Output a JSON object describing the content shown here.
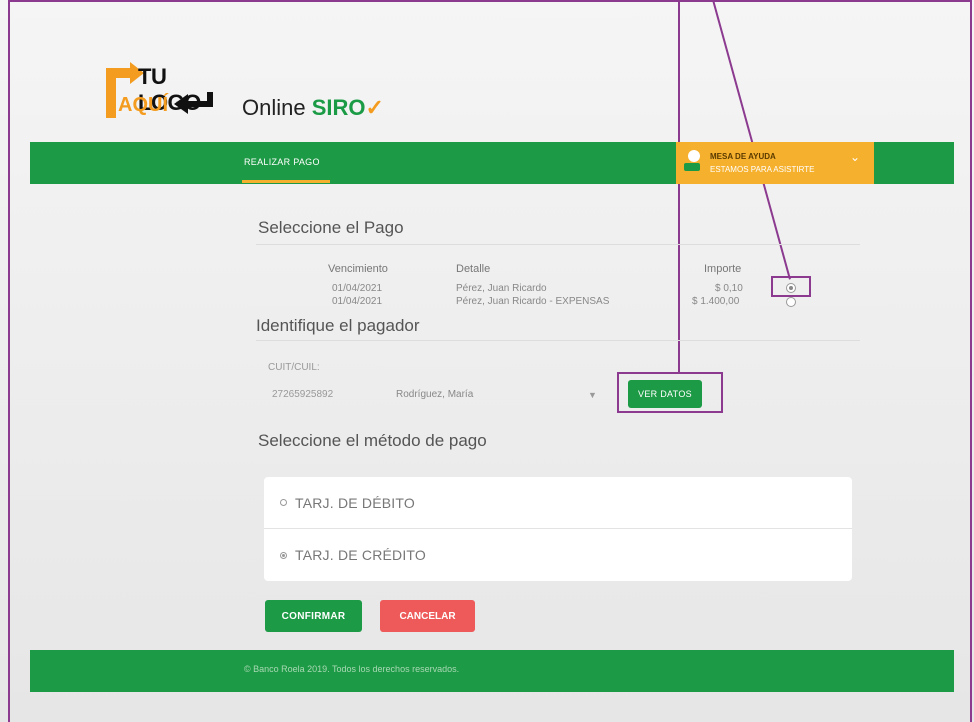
{
  "brand": {
    "logo_line1": "TU LOGO",
    "logo_line2": "AQUÍ",
    "app_prefix": "Online",
    "app_name": "SIRO",
    "accent_green": "#1d9a45",
    "accent_orange": "#f5b02d"
  },
  "nav": {
    "tab_realizar_pago": "REALIZAR PAGO",
    "help_title": "MESA DE AYUDA",
    "help_subtitle": "ESTAMOS PARA ASISTIRTE"
  },
  "payment_selection": {
    "title": "Seleccione el Pago",
    "columns": [
      "Vencimiento",
      "Detalle",
      "Importe"
    ],
    "rows": [
      {
        "vencimiento": "01/04/2021",
        "detalle": "Pérez, Juan Ricardo",
        "importe": "$ 0,10",
        "selected": true
      },
      {
        "vencimiento": "01/04/2021",
        "detalle": "Pérez, Juan Ricardo - EXPENSAS",
        "importe": "$ 1.400,00",
        "selected": false
      }
    ]
  },
  "payer": {
    "title": "Identifique el pagador",
    "cuit_label": "CUIT/CUIL:",
    "cuit_value": "27265925892",
    "payer_name": "Rodríguez, María",
    "view_button": "VER DATOS"
  },
  "method": {
    "title": "Seleccione el método de pago",
    "options": [
      {
        "label": "TARJ. DE DÉBITO",
        "selected": false
      },
      {
        "label": "TARJ. DE CRÉDITO",
        "selected": true
      }
    ]
  },
  "actions": {
    "confirm": "CONFIRMAR",
    "cancel": "CANCELAR"
  },
  "footer": {
    "text": "© Banco Roela 2019. Todos los derechos reservados."
  }
}
